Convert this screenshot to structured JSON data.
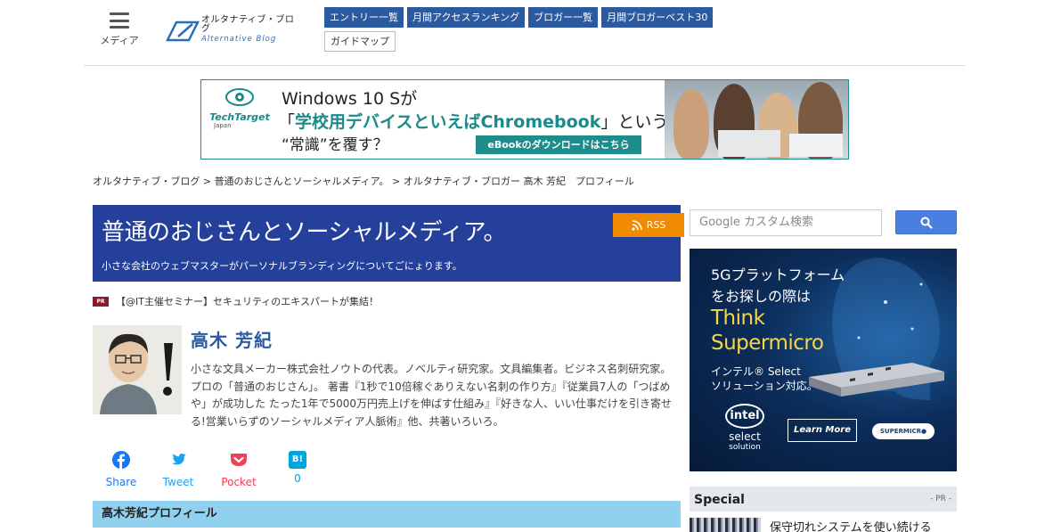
{
  "header": {
    "menu_label": "メディア",
    "logo_ja": "オルタナティブ・ブログ",
    "logo_en": "Alternative Blog",
    "nav_row1": [
      "エントリー一覧",
      "月間アクセスランキング",
      "ブロガー一覧",
      "月間ブロガーベスト30"
    ],
    "nav_row2": [
      "ガイドマップ"
    ]
  },
  "banner_ad": {
    "brand": "TechTarget",
    "brand_sub": "Japan",
    "line1": "Windows 10 Sが",
    "line2_open": "「",
    "line2_highlight": "学校用デバイスといえばChromebook",
    "line2_close": "」という",
    "line3": "“常識”を覆す？",
    "cta": "eBookのダウンロードはこちら"
  },
  "breadcrumb": {
    "items": [
      "オルタナティブ・ブログ",
      "普通のおじさんとソーシャルメディア。",
      "オルタナティブ・ブロガー 高木 芳紀　プロフィール"
    ],
    "separator": ">"
  },
  "blog": {
    "title": "普通のおじさんとソーシャルメディア。",
    "description": "小さな会社のウェブマスターがパーソナルブランディングについてごにょります。",
    "rss_label": "RSS"
  },
  "pr": {
    "badge": "PR",
    "text": "【@IT主催セミナー】セキュリティのエキスパートが集結！"
  },
  "author": {
    "name": "高木 芳紀",
    "bio": "小さな文具メーカー株式会社ノウトの代表。ノベルティ研究家。文具編集者。ビジネス名刺研究家。プロの「普通のおじさん」。 著書『1秒で10倍稼ぐありえない名刺の作り方』『従業員7人の「つばめや」が成功した たった1年で5000万円売上げを伸ばす仕組み』『好きな人、いい仕事だけを引き寄せる!営業いらずのソーシャルメディア人脈術』他、共著いろいろ。"
  },
  "share": {
    "facebook": "Share",
    "twitter": "Tweet",
    "pocket": "Pocket",
    "hatena_icon": "B!",
    "hatena_count": "0"
  },
  "section": {
    "profile_heading": "高木芳紀プロフィール"
  },
  "sidebar": {
    "search_placeholder": "Google カスタム検索",
    "ad": {
      "line1": "5Gプラットフォーム",
      "line2": "をお探しの際は",
      "think1": "Think",
      "think2": "Supermicro",
      "sub1": "インテル® Select",
      "sub2": "ソリューション対応。",
      "intel": "intel",
      "intel_s1": "select",
      "intel_s2": "solution",
      "learn": "Learn More",
      "supermicro": "SUPERMICR●"
    },
    "special": {
      "title": "Special",
      "pr": "- PR -",
      "item1": "保守切れシステムを使い続ける"
    }
  },
  "colors": {
    "nav_blue": "#2c5aa0",
    "blog_header": "#25409a",
    "rss_orange": "#f08a00",
    "section_bg": "#8fd1ee",
    "facebook": "#1877f2",
    "twitter": "#1da1f2",
    "pocket": "#ef4056",
    "hatena": "#00a4de"
  }
}
